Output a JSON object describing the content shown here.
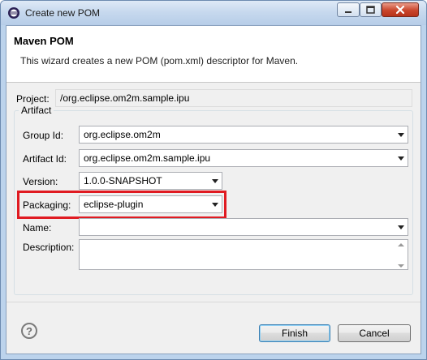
{
  "window": {
    "title": "Create new POM"
  },
  "header": {
    "title": "Maven POM",
    "description": "This wizard creates a new POM (pom.xml) descriptor for Maven."
  },
  "project": {
    "label": "Project:",
    "value": "/org.eclipse.om2m.sample.ipu"
  },
  "artifact": {
    "group_title": "Artifact",
    "group_id_label": "Group Id:",
    "group_id_value": "org.eclipse.om2m",
    "artifact_id_label": "Artifact Id:",
    "artifact_id_value": "org.eclipse.om2m.sample.ipu",
    "version_label": "Version:",
    "version_value": "1.0.0-SNAPSHOT",
    "packaging_label": "Packaging:",
    "packaging_value": "eclipse-plugin",
    "name_label": "Name:",
    "name_value": "",
    "description_label": "Description:",
    "description_value": ""
  },
  "buttons": {
    "help_glyph": "?",
    "finish_label": "Finish",
    "cancel_label": "Cancel"
  },
  "colors": {
    "highlight_box": "#e01b22",
    "title_bar": "#c7d9ee",
    "close_button": "#c9452b"
  },
  "icons": [
    "eclipse-app-icon",
    "minimize-icon",
    "maximize-icon",
    "close-icon",
    "dropdown-arrow-icon",
    "help-icon",
    "spinner-up-icon",
    "spinner-down-icon"
  ]
}
